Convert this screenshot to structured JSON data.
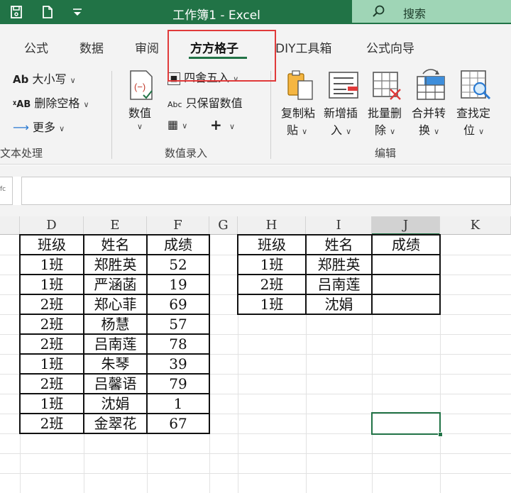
{
  "app": {
    "title": "工作簿1  -  Excel",
    "search_label": "搜索"
  },
  "tabs": [
    "公式",
    "数据",
    "审阅",
    "方方格子",
    "DIY工具箱",
    "公式向导"
  ],
  "active_tab": "方方格子",
  "ribbon": {
    "text_group": {
      "case_label": "大小写",
      "remove_space_label": "删除空格",
      "more_label": "更多",
      "group_label": "文本处理"
    },
    "number_group": {
      "value_label": "数值",
      "round_label": "四舍五入",
      "keep_value_label": "只保留数值",
      "group_label": "数值录入"
    },
    "edit_group": {
      "copy_paste_1": "复制粘",
      "copy_paste_2": "贴",
      "insert_1": "新增插",
      "insert_2": "入",
      "batch_delete_1": "批量删",
      "batch_delete_2": "除",
      "merge_1": "合并转",
      "merge_2": "换",
      "find_1": "查找定",
      "find_2": "位",
      "group_label": "编辑"
    }
  },
  "sheet": {
    "columns": [
      "D",
      "E",
      "F",
      "G",
      "H",
      "I",
      "J",
      "K"
    ],
    "selected_column": "J",
    "table1": {
      "headers": [
        "班级",
        "姓名",
        "成绩"
      ],
      "rows": [
        [
          "1班",
          "郑胜英",
          "52"
        ],
        [
          "1班",
          "严涵菡",
          "19"
        ],
        [
          "2班",
          "郑心菲",
          "69"
        ],
        [
          "2班",
          "杨慧",
          "57"
        ],
        [
          "2班",
          "吕南莲",
          "78"
        ],
        [
          "1班",
          "朱琴",
          "39"
        ],
        [
          "2班",
          "吕馨语",
          "79"
        ],
        [
          "1班",
          "沈娟",
          "1"
        ],
        [
          "2班",
          "金翠花",
          "67"
        ]
      ]
    },
    "table2": {
      "headers": [
        "班级",
        "姓名",
        "成绩"
      ],
      "rows": [
        [
          "1班",
          "郑胜英",
          ""
        ],
        [
          "2班",
          "吕南莲",
          ""
        ],
        [
          "1班",
          "沈娟",
          ""
        ]
      ]
    }
  }
}
